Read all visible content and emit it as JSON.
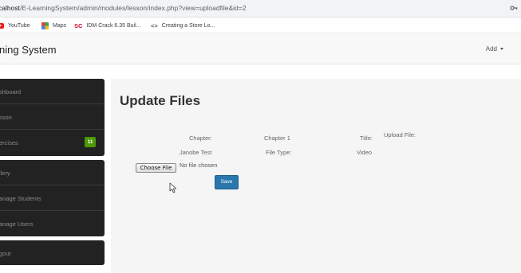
{
  "browser": {
    "url_host": "calhost",
    "url_path": "/E-LearningSystem/admin/modules/lesson/index.php?view=uploadfile&id=2",
    "bookmarks": [
      {
        "label": "YouTube",
        "icon": "youtube-icon"
      },
      {
        "label": "Maps",
        "icon": "maps-icon"
      },
      {
        "label": "IDM Crack 6.35 Buil...",
        "icon_text": "SC"
      },
      {
        "label": "Creating a Store Lo...",
        "icon_text": "<>"
      }
    ]
  },
  "navbar": {
    "brand": "ning System",
    "add_menu": "Add"
  },
  "sidebar": {
    "items": [
      {
        "label": "shboard"
      },
      {
        "label": "sson"
      },
      {
        "label": "ercises",
        "badge": "11"
      },
      {
        "label": "llery"
      },
      {
        "label": "anage Students"
      },
      {
        "label": "anage Users"
      },
      {
        "label": "gout"
      }
    ]
  },
  "main": {
    "title": "Update Files",
    "fields": {
      "chapter_label": "Chapter:",
      "chapter_value": "Chapter 1",
      "title_label": "Title:",
      "upload_label": "Upload File:",
      "title_value": "Janobe Test",
      "file_type_label": "File Type:",
      "file_type_value": "Video"
    },
    "file_input": {
      "button_label": "Choose File",
      "status": "No file chosen"
    },
    "save_label": "Save"
  },
  "colors": {
    "sidebar_bg": "#222222",
    "badge_green": "#4e9a06",
    "save_blue": "#2a77ad",
    "main_bg": "#f5f5f5"
  }
}
